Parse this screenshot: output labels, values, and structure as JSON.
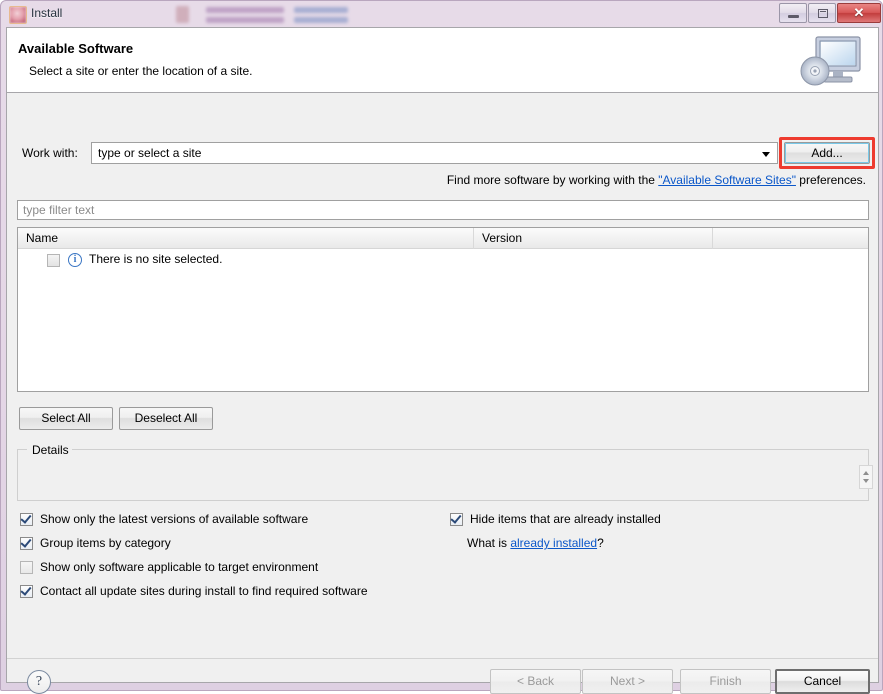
{
  "window": {
    "title": "Install",
    "icon": "install-app-icon",
    "controls": {
      "minimize": "minimize-icon",
      "maximize": "maximize-icon",
      "close": "✕"
    }
  },
  "header": {
    "title": "Available Software",
    "subtitle": "Select a site or enter the location of a site.",
    "icon": "computer-disc-icon"
  },
  "workwith": {
    "label": "Work with:",
    "value": "",
    "placeholder": "type or select a site",
    "add_label": "Add...",
    "annotation_color": "#ee3b2f"
  },
  "findmore": {
    "prefix": "Find more software by working with the ",
    "link": "\"Available Software Sites\"",
    "suffix": " preferences."
  },
  "filter": {
    "placeholder": "type filter text",
    "value": ""
  },
  "table": {
    "columns": [
      "Name",
      "Version",
      ""
    ],
    "rows": [
      {
        "checked": false,
        "icon": "info-icon",
        "name": "There is no site selected.",
        "version": ""
      }
    ]
  },
  "selection_buttons": {
    "select_all": "Select All",
    "deselect_all": "Deselect All"
  },
  "details": {
    "legend": "Details",
    "text": ""
  },
  "options": {
    "left": [
      {
        "label": "Show only the latest versions of available software",
        "checked": true
      },
      {
        "label": "Group items by category",
        "checked": true
      },
      {
        "label": "Show only software applicable to target environment",
        "checked": false
      },
      {
        "label": "Contact all update sites during install to find required software",
        "checked": true
      }
    ],
    "right": [
      {
        "label": "Hide items that are already installed",
        "checked": true
      }
    ],
    "whatis": {
      "prefix": "What is ",
      "link": "already installed",
      "suffix": "?"
    }
  },
  "footer": {
    "help": "?",
    "back": "< Back",
    "next": "Next >",
    "finish": "Finish",
    "cancel": "Cancel"
  }
}
